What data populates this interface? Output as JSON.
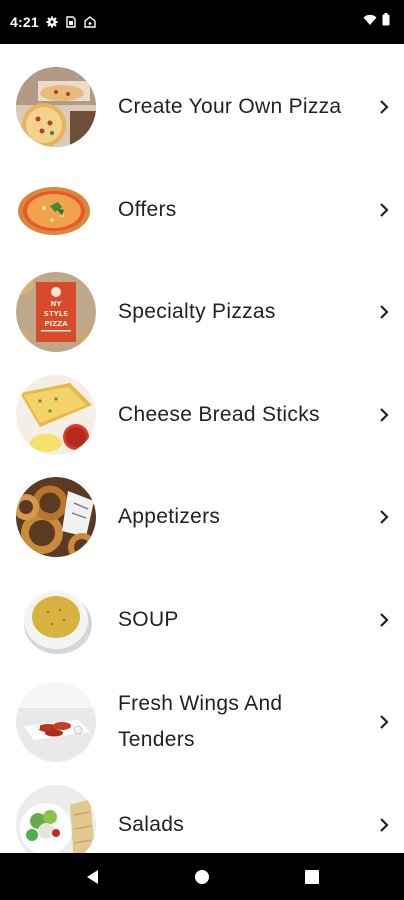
{
  "status_bar": {
    "time": "4:21",
    "left_icons": [
      "gear-icon",
      "sim-icon",
      "shield-icon"
    ],
    "right_icons": [
      "wifi-icon",
      "battery-icon"
    ]
  },
  "menu": {
    "items": [
      {
        "label": "Create Your Own Pizza",
        "thumbnail": "pizza-box-photo"
      },
      {
        "label": "Offers",
        "thumbnail": "pizza-photo"
      },
      {
        "label": "Specialty Pizzas",
        "thumbnail": "ny-style-pizza-sign-photo",
        "thumbnail_text": [
          "NY",
          "STYLE",
          "PIZZA"
        ]
      },
      {
        "label": "Cheese Bread Sticks",
        "thumbnail": "cheese-bread-photo"
      },
      {
        "label": "Appetizers",
        "thumbnail": "onion-rings-photo"
      },
      {
        "label": "SOUP",
        "thumbnail": "soup-bowl-photo"
      },
      {
        "label": "Fresh Wings And Tenders",
        "thumbnail": "wings-plate-photo"
      },
      {
        "label": "Salads",
        "thumbnail": "salad-photo"
      }
    ]
  },
  "nav_bar": {
    "icons": [
      "back-icon",
      "home-icon",
      "recents-icon"
    ]
  },
  "colors": {
    "status_bar_bg": "#000000",
    "text": "#222222",
    "background": "#ffffff"
  }
}
